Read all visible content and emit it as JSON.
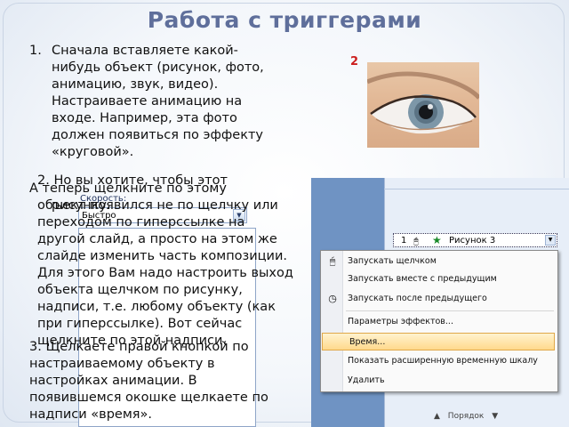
{
  "slide": {
    "title": "Работа с триггерами",
    "item1_number": "1.",
    "item1_text": "Сначала вставляете какой-нибудь объект (рисунок, фото, анимацию, звук, видео). Настраиваете анимацию на входе. Например, эта фото должен появиться по эффекту «круговой».",
    "item2_line_a": "2. Но вы хотите, чтобы этот",
    "item2_line_b": "А теперь щелкните по этому",
    "item2_text": "объект появился не по щелчку или переходом по гиперссылке на другой слайд, а просто на этом же слайде изменить часть композиции. Для этого Вам надо настроить выход объекта щелчком по рисунку, надписи, т.е. любому объекту (как при гиперссылке). Вот сейчас щелкните по этой надписи.",
    "item2_overlap": "рисунку.",
    "item3_text": "3. Щелкаете правой кнопкой по настраиваемому объекту в настройках анимации. В появившемся окошке щелкаете по надписи «время».",
    "badge": "2"
  },
  "animation_pane": {
    "speed_label": "Скорость:",
    "speed_value": "Быстро",
    "list_item_number": "1",
    "list_item_label": "Рисунок 3",
    "bottom_buttons": [
      "▲",
      "Порядок",
      "▼"
    ]
  },
  "context_menu": {
    "items": [
      {
        "label": "Запускать щелчком",
        "icon": "mouse-click-icon"
      },
      {
        "label": "Запускать вместе с предыдущим",
        "icon": ""
      },
      {
        "label": "Запускать после предыдущего",
        "icon": "clock-icon"
      },
      {
        "label": "Параметры эффектов...",
        "icon": ""
      },
      {
        "label": "Время...",
        "icon": "",
        "highlighted": true
      },
      {
        "label": "Показать расширенную временную шкалу",
        "icon": ""
      },
      {
        "label": "Удалить",
        "icon": ""
      }
    ]
  },
  "colors": {
    "title": "#5f6f9b",
    "badge": "#cc1e1e",
    "pane_bg": "#6f93c3",
    "menu_highlight": "#ffd98c"
  }
}
